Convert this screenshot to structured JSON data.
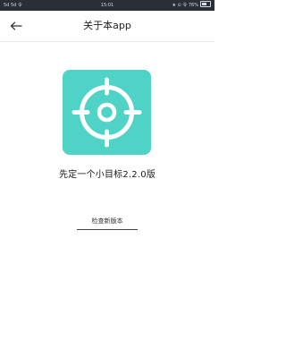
{
  "status_bar": {
    "left": "5d 5d 令",
    "time": "15:01",
    "right": "★ ⊙ 令 76%"
  },
  "nav": {
    "title": "关于本app",
    "back_icon": "arrow-left-icon"
  },
  "logo": {
    "icon": "crosshair-target-icon",
    "background": "#4fd3c6"
  },
  "version_text": "先定一个小目标2.2.0版",
  "check_update_label": "检查新版本"
}
